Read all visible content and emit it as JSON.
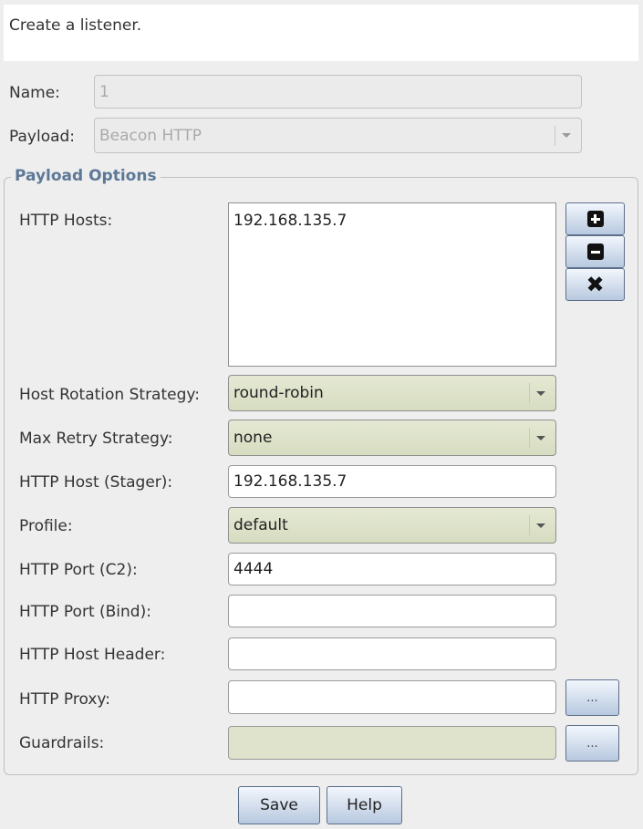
{
  "dialog": {
    "description": "Create a listener."
  },
  "form": {
    "name_label": "Name:",
    "name_value": "1",
    "payload_label": "Payload:",
    "payload_value": "Beacon HTTP"
  },
  "payload_options": {
    "title": "Payload Options",
    "http_hosts_label": "HTTP Hosts:",
    "http_hosts": [
      "192.168.135.7"
    ],
    "host_rotation_label": "Host Rotation Strategy:",
    "host_rotation_value": "round-robin",
    "max_retry_label": "Max Retry Strategy:",
    "max_retry_value": "none",
    "stager_host_label": "HTTP Host (Stager):",
    "stager_host_value": "192.168.135.7",
    "profile_label": "Profile:",
    "profile_value": "default",
    "port_c2_label": "HTTP Port (C2):",
    "port_c2_value": "4444",
    "port_bind_label": "HTTP Port (Bind):",
    "port_bind_value": "",
    "host_header_label": "HTTP Host Header:",
    "host_header_value": "",
    "proxy_label": "HTTP Proxy:",
    "proxy_value": "",
    "guardrails_label": "Guardrails:",
    "guardrails_value": "",
    "ellipsis_label": "..."
  },
  "buttons": {
    "save": "Save",
    "help": "Help"
  },
  "icons": {
    "add": "plus-box-icon",
    "remove": "minus-box-icon",
    "clear": "x-icon"
  },
  "colors": {
    "group_title": "#5e7897",
    "combo_bg": "#dfe3cc",
    "button_border": "#5c6f8a"
  }
}
